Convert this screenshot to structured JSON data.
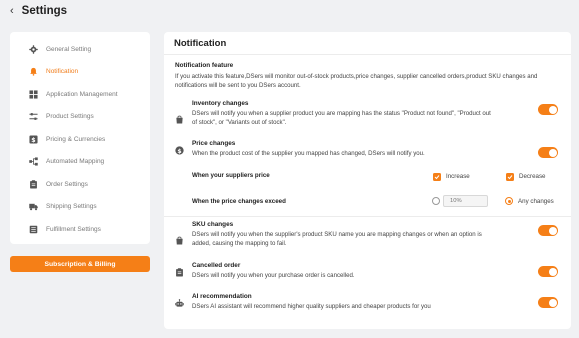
{
  "header": {
    "title": "Settings"
  },
  "sidebar": {
    "items": [
      {
        "label": "General Setting",
        "icon": "gear-icon",
        "active": false
      },
      {
        "label": "Notification",
        "icon": "bell-icon",
        "active": true
      },
      {
        "label": "Application Management",
        "icon": "apps-icon",
        "active": false
      },
      {
        "label": "Product Settings",
        "icon": "sliders-icon",
        "active": false
      },
      {
        "label": "Pricing & Currencies",
        "icon": "dollar-icon",
        "active": false
      },
      {
        "label": "Automated Mapping",
        "icon": "mapping-icon",
        "active": false
      },
      {
        "label": "Order Settings",
        "icon": "clipboard-icon",
        "active": false
      },
      {
        "label": "Shipping Settings",
        "icon": "truck-icon",
        "active": false
      },
      {
        "label": "Fulfillment Settings",
        "icon": "list-icon",
        "active": false
      }
    ],
    "subscription_button": "Subscription & Billing"
  },
  "main": {
    "title": "Notification",
    "feature_heading": "Notification feature",
    "feature_desc": "If you activate this feature,DSers will monitor out-of-stock products,price changes, supplier cancelled orders,product SKU changes and notifications will be sent to you DSers account.",
    "inventory": {
      "title": "Inventory changes",
      "desc": "DSers will notify you when a supplier product you are mapping has the status \"Product not found\", \"Product out of stock\", or \"Variants out of stock\".",
      "enabled": true
    },
    "price": {
      "title": "Price changes",
      "desc": "When the product cost of the supplier you mapped has changed, DSers will notify you.",
      "enabled": true,
      "when_label": "When your suppliers price",
      "increase_label": "Increase",
      "increase_checked": true,
      "decrease_label": "Decrease",
      "decrease_checked": true,
      "exceed_label": "When the price changes exceed",
      "percent_placeholder": "10%",
      "any_changes_label": "Any changes",
      "selected_option": "Any changes"
    },
    "sku": {
      "title": "SKU changes",
      "desc": "DSers will notify you when the supplier's product SKU name you are mapping changes or when an option is added, causing the mapping to fail.",
      "enabled": true
    },
    "cancelled": {
      "title": "Cancelled order",
      "desc": "DSers will notify you when your purchase order is cancelled.",
      "enabled": true
    },
    "ai": {
      "title": "AI recommendation",
      "desc": "DSers AI assistant will recommend higher quality suppliers and cheaper products for you",
      "enabled": true
    }
  },
  "colors": {
    "accent": "#f57f17",
    "background": "#f0f1f3"
  }
}
